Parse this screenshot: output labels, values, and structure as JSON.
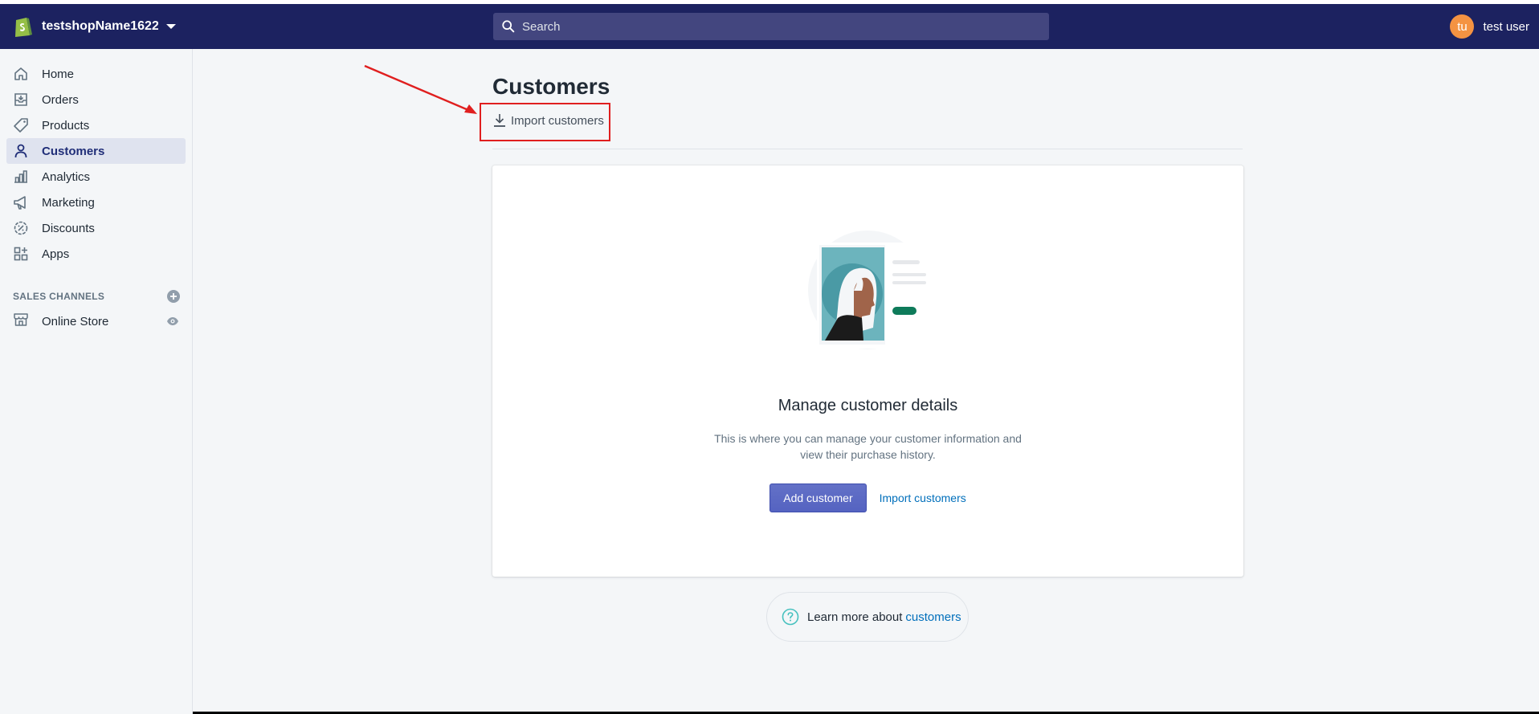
{
  "topbar": {
    "store_name": "testshopName1622...",
    "search_placeholder": "Search",
    "user_initials": "tu",
    "user_name": "test user"
  },
  "sidebar": {
    "items": [
      {
        "label": "Home",
        "icon": "home-icon"
      },
      {
        "label": "Orders",
        "icon": "orders-icon"
      },
      {
        "label": "Products",
        "icon": "tag-icon"
      },
      {
        "label": "Customers",
        "icon": "person-icon",
        "active": true
      },
      {
        "label": "Analytics",
        "icon": "bar-chart-icon"
      },
      {
        "label": "Marketing",
        "icon": "megaphone-icon"
      },
      {
        "label": "Discounts",
        "icon": "discount-icon"
      },
      {
        "label": "Apps",
        "icon": "apps-icon"
      }
    ],
    "channels_title": "SALES CHANNELS",
    "channel_items": [
      {
        "label": "Online Store",
        "icon": "store-icon"
      }
    ]
  },
  "page": {
    "title": "Customers",
    "import_label": "Import customers"
  },
  "card": {
    "heading": "Manage customer details",
    "description": "This is where you can manage your customer information and view their purchase history.",
    "add_button": "Add customer",
    "import_link": "Import customers"
  },
  "learn_more": {
    "text": "Learn more about",
    "link": "customers"
  },
  "colors": {
    "topbar": "#1c2260",
    "accent": "#5c6ac4",
    "highlight": "#e01f1f",
    "link": "#006fbb"
  }
}
